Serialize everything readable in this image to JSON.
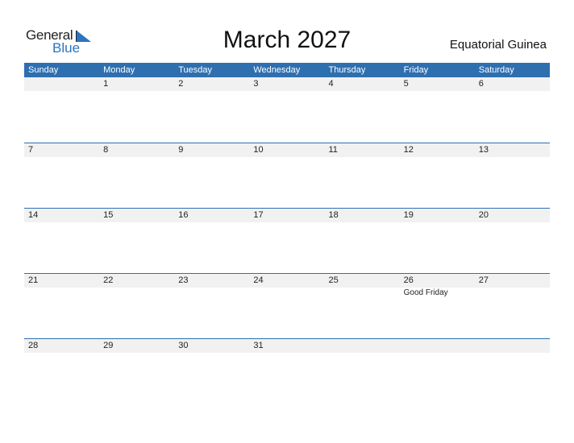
{
  "logo": {
    "general": "General",
    "blue": "Blue"
  },
  "title": "March 2027",
  "country": "Equatorial Guinea",
  "weekdays": [
    "Sunday",
    "Monday",
    "Tuesday",
    "Wednesday",
    "Thursday",
    "Friday",
    "Saturday"
  ],
  "weeks": [
    {
      "days": [
        "",
        "1",
        "2",
        "3",
        "4",
        "5",
        "6"
      ],
      "events": [
        "",
        "",
        "",
        "",
        "",
        "",
        ""
      ]
    },
    {
      "days": [
        "7",
        "8",
        "9",
        "10",
        "11",
        "12",
        "13"
      ],
      "events": [
        "",
        "",
        "",
        "",
        "",
        "",
        ""
      ]
    },
    {
      "days": [
        "14",
        "15",
        "16",
        "17",
        "18",
        "19",
        "20"
      ],
      "events": [
        "",
        "",
        "",
        "",
        "",
        "",
        ""
      ]
    },
    {
      "days": [
        "21",
        "22",
        "23",
        "24",
        "25",
        "26",
        "27"
      ],
      "events": [
        "",
        "",
        "",
        "",
        "",
        "Good Friday",
        ""
      ]
    },
    {
      "days": [
        "28",
        "29",
        "30",
        "31",
        "",
        "",
        ""
      ],
      "events": [
        "",
        "",
        "",
        "",
        "",
        "",
        ""
      ]
    }
  ],
  "colors": {
    "accent": "#2e6fb0",
    "strip": "#f1f1f1"
  }
}
